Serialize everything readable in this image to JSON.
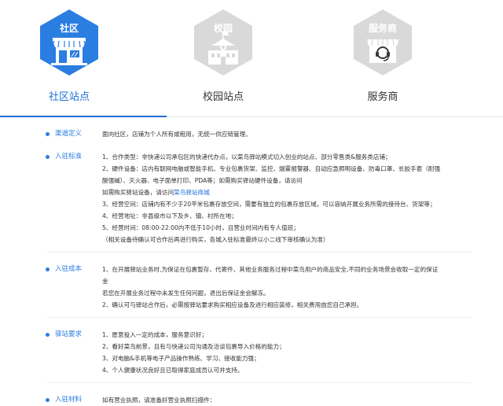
{
  "tabs": [
    {
      "badge": "社区",
      "label": "社区站点",
      "active": true,
      "color": "#2a7de1"
    },
    {
      "badge": "校园",
      "label": "校园站点",
      "active": false,
      "color": "#d6d6d6"
    },
    {
      "badge": "服务商",
      "label": "服务商",
      "active": false,
      "color": "#d6d6d6"
    }
  ],
  "sections": [
    {
      "title": "渠道定义",
      "lines": [
        "面向社区，店铺为个人所有或租用，无统一供应链管理。"
      ]
    },
    {
      "title": "入驻标准",
      "lines": [
        "1、合作类型：非快递公司承包区的快递代办点，以菜鸟驿站模式切入创业的站点、部分零售类&服务类店铺；",
        "2、硬件设备：店内有联网电脑或智能手机、专业包裹货架、监控、烟雾报警器、自动应急照明设备、防毒口罩、长胶手套（耐强",
        "酸强碱）、灭火器、电子面单打印、PDA等；如需购买驿站硬件设备，请访问",
        "如需购买驿站设备，请访问",
        "3、经营空间：店铺内有不少于20平米包裹存放空间，需要有独立的包裹存放区域，可以容纳开展业务所需的接待台、货架等；",
        "4、经营地址：非县级市以下及乡、镇、村所在地；",
        "5、经营时间：08:00-22:00内不低于10小时，且营业时间内有专人值班；",
        "（相关设备待确认可合作后再进行购买，各城入驻标准最终以小二线下审核确认为准）"
      ],
      "link_text": "菜鸟驿站商城"
    },
    {
      "title": "入驻成本",
      "lines": [
        "1、在开展驿站业务时,为保证在包裹暂存、代寄件、其他业务服务过程中菜鸟用户的商品安全,不同的业务场景会收取一定的保证",
        "金",
        "若您在开展业务过程中未发生任何问题，退出后保证金会解冻。",
        "2、确认可与驿站合作后，必需按驿站要求购买相应设备及进行相应装修，相关费用由您自己承担。"
      ]
    },
    {
      "title": "驿站要求",
      "lines": [
        "1、愿意投入一定的成本，服务意识好；",
        "2、看好菜鸟前景，且有与快递公司沟通及洽谈包裹导入价格的能力；",
        "3、对电脑&手机等电子产品操作熟练、学习、接收能力强；",
        "4、个人健康状况良好且已取得家庭成员认可并支持。"
      ]
    },
    {
      "title": "入驻材料",
      "lines": [
        "如有营业执照，请准备好营业执照扫描件："
      ]
    }
  ]
}
